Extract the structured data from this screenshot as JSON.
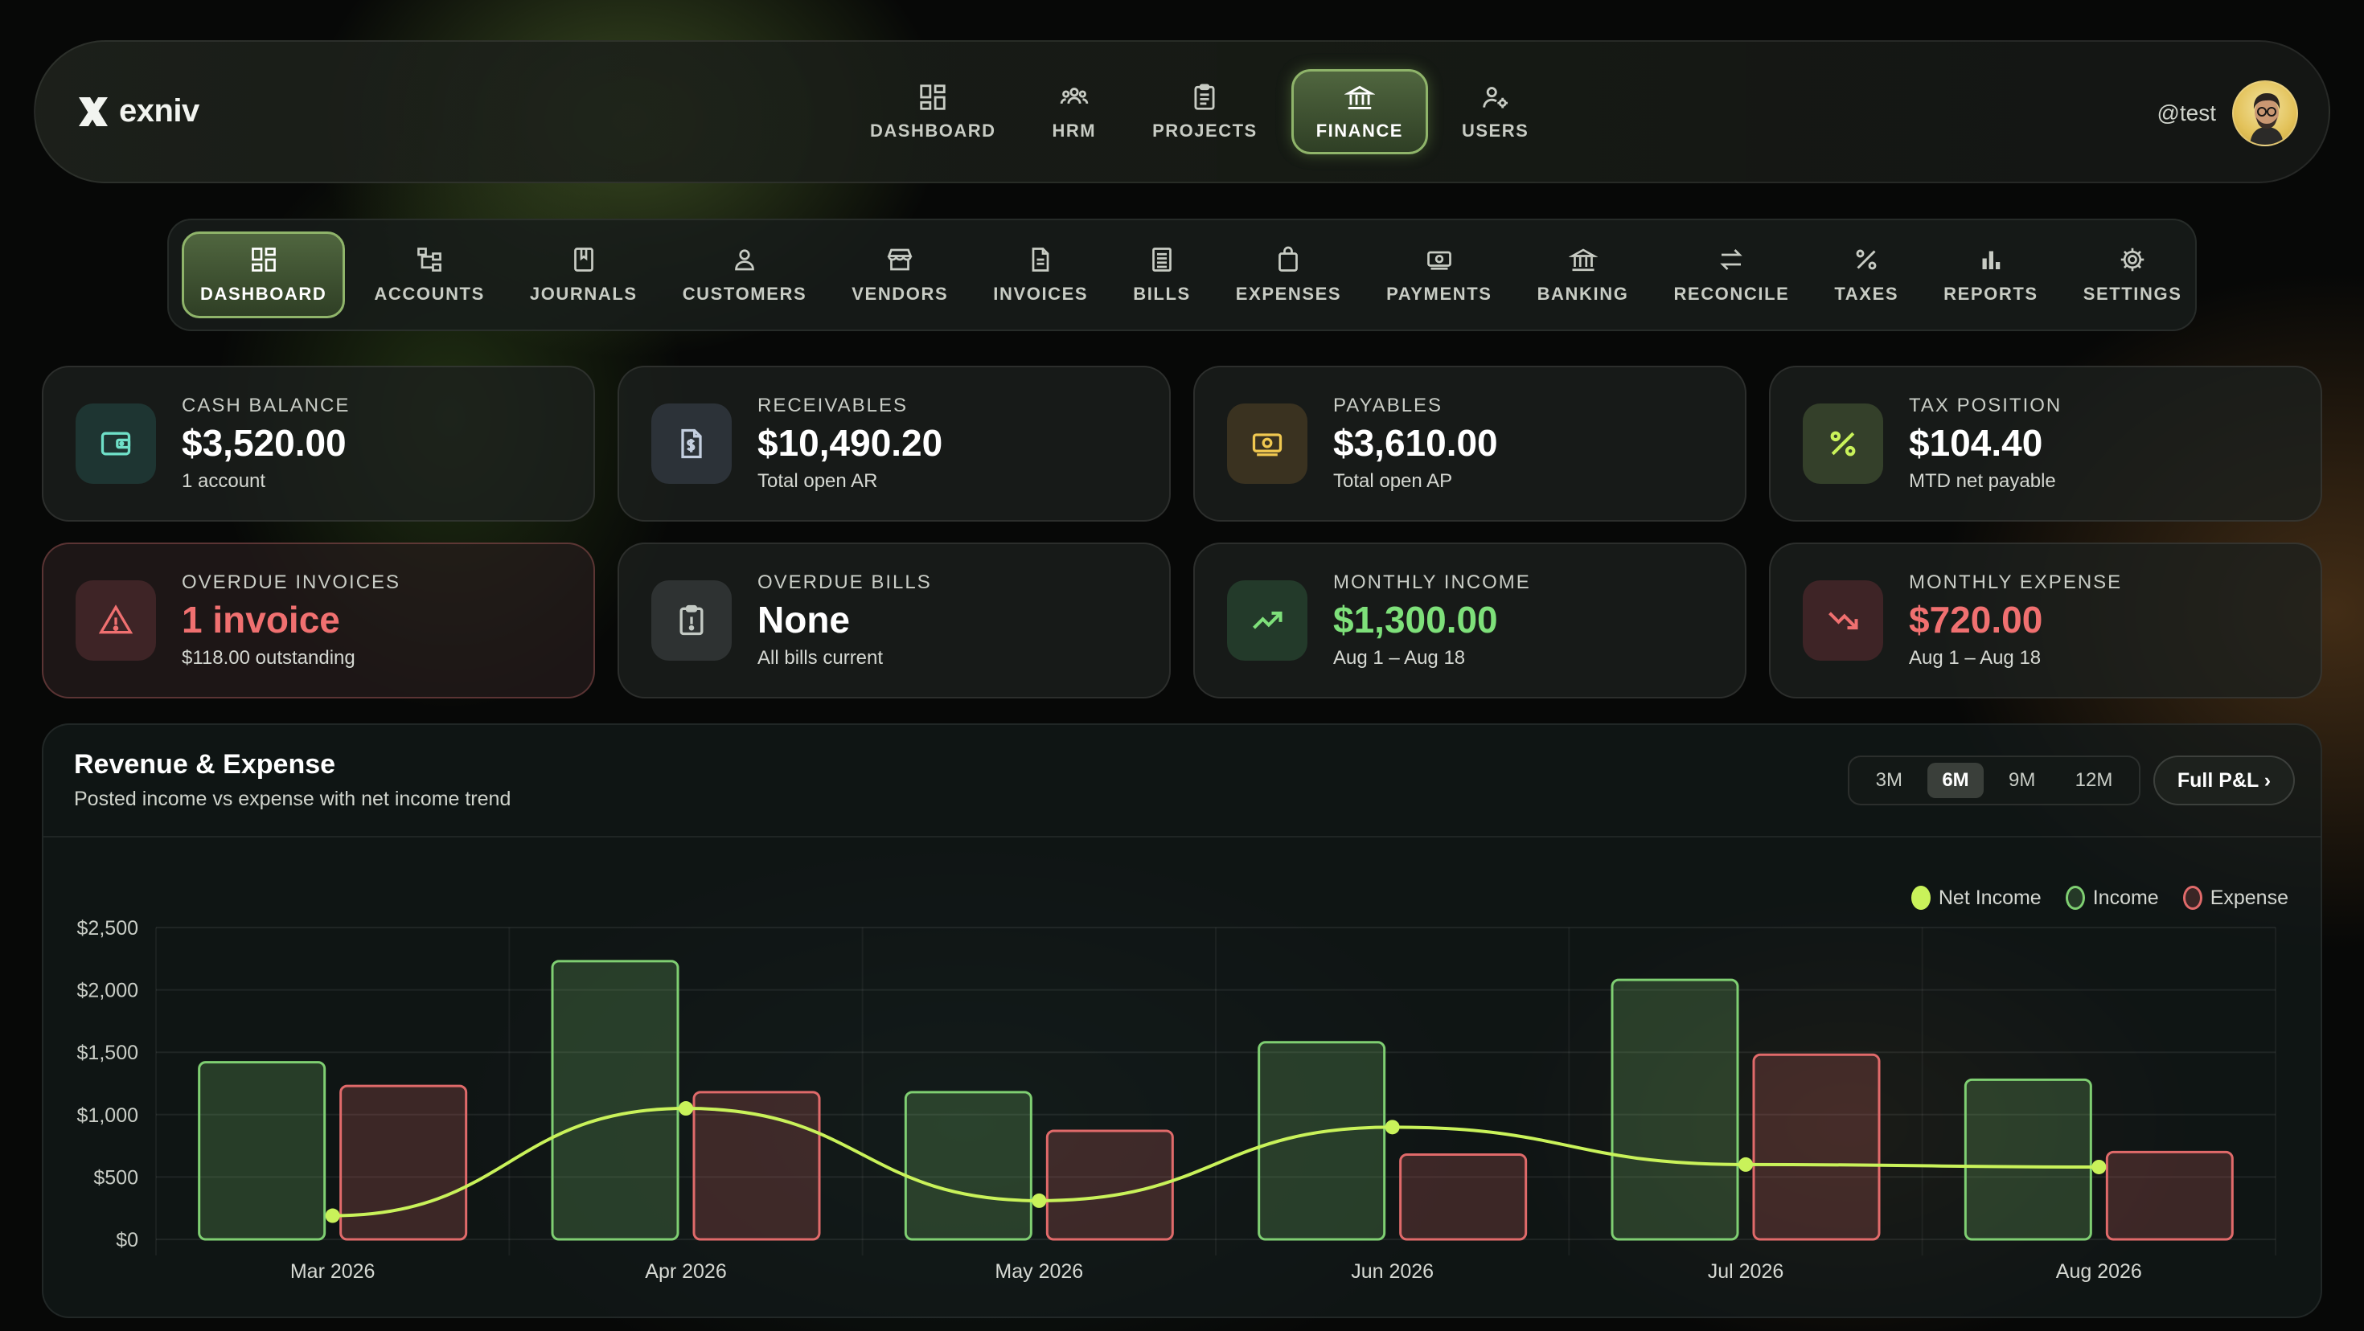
{
  "app": {
    "name": "exniv"
  },
  "topnav": {
    "items": [
      {
        "label": "DASHBOARD",
        "icon": "grid-icon"
      },
      {
        "label": "HRM",
        "icon": "people-icon"
      },
      {
        "label": "PROJECTS",
        "icon": "clipboard-icon"
      },
      {
        "label": "FINANCE",
        "icon": "bank-icon",
        "active": true
      },
      {
        "label": "USERS",
        "icon": "user-gear-icon"
      }
    ]
  },
  "user": {
    "handle": "@test"
  },
  "subnav": {
    "items": [
      {
        "label": "DASHBOARD",
        "icon": "grid-icon",
        "active": true
      },
      {
        "label": "ACCOUNTS",
        "icon": "tree-icon"
      },
      {
        "label": "JOURNALS",
        "icon": "book-icon"
      },
      {
        "label": "CUSTOMERS",
        "icon": "person-icon"
      },
      {
        "label": "VENDORS",
        "icon": "store-icon"
      },
      {
        "label": "INVOICES",
        "icon": "document-icon"
      },
      {
        "label": "BILLS",
        "icon": "list-icon"
      },
      {
        "label": "EXPENSES",
        "icon": "bag-icon"
      },
      {
        "label": "PAYMENTS",
        "icon": "cash-icon"
      },
      {
        "label": "BANKING",
        "icon": "bank-icon"
      },
      {
        "label": "RECONCILE",
        "icon": "swap-icon"
      },
      {
        "label": "TAXES",
        "icon": "percent-icon"
      },
      {
        "label": "REPORTS",
        "icon": "bar-chart-icon"
      },
      {
        "label": "SETTINGS",
        "icon": "gear-icon"
      }
    ]
  },
  "cards": [
    {
      "label": "CASH BALANCE",
      "value": "$3,520.00",
      "sub": "1 account",
      "icon": "wallet-icon",
      "tone": "teal"
    },
    {
      "label": "RECEIVABLES",
      "value": "$10,490.20",
      "sub": "Total open AR",
      "icon": "invoice-dollar-icon",
      "tone": "slate"
    },
    {
      "label": "PAYABLES",
      "value": "$3,610.00",
      "sub": "Total open AP",
      "icon": "cash-icon",
      "tone": "amber"
    },
    {
      "label": "TAX POSITION",
      "value": "$104.40",
      "sub": "MTD net payable",
      "icon": "percent-icon",
      "tone": "lime"
    },
    {
      "label": "OVERDUE INVOICES",
      "value": "1 invoice",
      "sub": "$118.00 outstanding",
      "icon": "warning-icon",
      "tone": "red"
    },
    {
      "label": "OVERDUE BILLS",
      "value": "None",
      "sub": "All bills current",
      "icon": "clipboard-alert-icon",
      "tone": "gray"
    },
    {
      "label": "MONTHLY INCOME",
      "value": "$1,300.00",
      "sub": "Aug 1 – Aug 18",
      "icon": "trend-up-icon",
      "tone": "green"
    },
    {
      "label": "MONTHLY EXPENSE",
      "value": "$720.00",
      "sub": "Aug 1 – Aug 18",
      "icon": "trend-down-icon",
      "tone": "red"
    }
  ],
  "panel": {
    "title": "Revenue & Expense",
    "subtitle": "Posted income vs expense with net income trend",
    "ranges": [
      "3M",
      "6M",
      "9M",
      "12M"
    ],
    "active_range": "6M",
    "full_pl_label": "Full P&L ›"
  },
  "colors": {
    "accent": "#8fb46a",
    "income": "#7fcf72",
    "expense": "#e06a6a",
    "net": "#c9f25a"
  },
  "chart_data": {
    "type": "bar",
    "categories": [
      "Mar 2026",
      "Apr 2026",
      "May 2026",
      "Jun 2026",
      "Jul 2026",
      "Aug 2026"
    ],
    "series": [
      {
        "name": "Income",
        "values": [
          1420,
          2230,
          1180,
          1580,
          2080,
          1280
        ]
      },
      {
        "name": "Expense",
        "values": [
          1230,
          1180,
          870,
          680,
          1480,
          700
        ]
      },
      {
        "name": "Net Income",
        "type": "line",
        "values": [
          190,
          1050,
          310,
          900,
          600,
          580
        ]
      }
    ],
    "legend": [
      "Net Income",
      "Income",
      "Expense"
    ],
    "legend_position": "top-right",
    "yticks": [
      "$0",
      "$500",
      "$1,000",
      "$1,500",
      "$2,000",
      "$2,500"
    ],
    "ylim": [
      0,
      2500
    ],
    "grid": true
  }
}
